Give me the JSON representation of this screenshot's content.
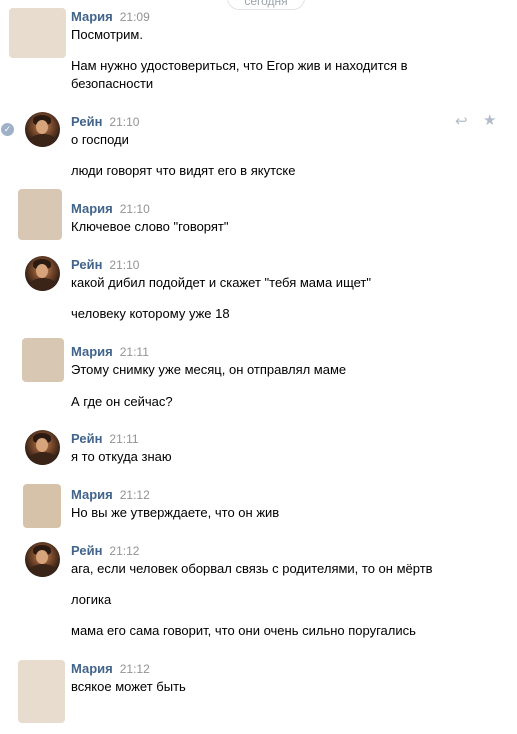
{
  "date_separator": "сегодня",
  "messages": [
    {
      "author": "Мария",
      "time": "21:09",
      "lines": [
        "Посмотрим.",
        "Нам нужно удостовериться, что Егор жив и находится в",
        "безопасности"
      ]
    },
    {
      "author": "Рейн",
      "time": "21:10",
      "lines": [
        "о господи",
        "люди говорят что видят его в якутске"
      ]
    },
    {
      "author": "Мария",
      "time": "21:10",
      "lines": [
        "Ключевое слово \"говорят\""
      ]
    },
    {
      "author": "Рейн",
      "time": "21:10",
      "lines": [
        "какой дибил подойдет и скажет \"тебя мама ищет\"",
        "человеку которому уже 18"
      ]
    },
    {
      "author": "Мария",
      "time": "21:11",
      "lines": [
        "Этому снимку уже месяц, он отправлял маме",
        "А где он сейчас?"
      ]
    },
    {
      "author": "Рейн",
      "time": "21:11",
      "lines": [
        "я то откуда знаю"
      ]
    },
    {
      "author": "Мария",
      "time": "21:12",
      "lines": [
        "Но вы же утверждаете, что он жив"
      ]
    },
    {
      "author": "Рейн",
      "time": "21:12",
      "lines": [
        "ага, если человек оборвал связь с родителями, то он мёртв",
        "логика",
        "мама его сама говорит, что они очень сильно поругались"
      ]
    },
    {
      "author": "Мария",
      "time": "21:12",
      "lines": [
        "всякое может быть"
      ]
    }
  ],
  "icons": {
    "selected_check": "check-icon",
    "reply": "reply-icon",
    "favorite": "star-icon"
  },
  "colors": {
    "author": "#42648b",
    "time": "#939393",
    "text": "#000000",
    "action_icons": "#b3bdc8"
  }
}
